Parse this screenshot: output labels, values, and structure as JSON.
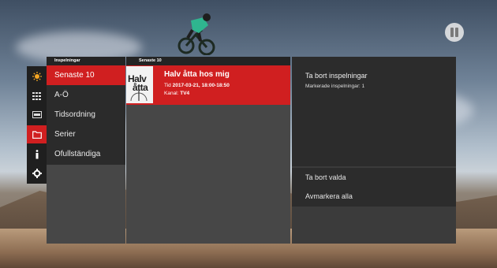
{
  "headers": {
    "left": "Inspelningar",
    "middle": "Senaste 10"
  },
  "rail": [
    {
      "icon": "sun-icon",
      "active": true
    },
    {
      "icon": "grid-icon",
      "active": false
    },
    {
      "icon": "film-icon",
      "active": false
    },
    {
      "icon": "folder-icon",
      "active": true
    },
    {
      "icon": "info-icon",
      "active": false
    },
    {
      "icon": "gear-icon",
      "active": false
    }
  ],
  "categories": [
    "Senaste 10",
    "A-Ö",
    "Tidsordning",
    "Serier",
    "Ofullständiga"
  ],
  "recording": {
    "thumb_line1": "Halv",
    "thumb_line2": "åtta",
    "title": "Halv åtta hos mig",
    "time_label": "Tid",
    "time_value": "2017-03-21, 18:00-18:50",
    "channel_label": "Kanal:",
    "channel_value": "TV4"
  },
  "delete_panel": {
    "title": "Ta bort inspelningar",
    "marked_label": "Markerade inspelningar: 1"
  },
  "actions": [
    "Ta bort valda",
    "Avmarkera alla"
  ],
  "colors": {
    "accent": "#d01f20",
    "panel_dark": "#2b2b2b",
    "panel_mid": "#474747"
  }
}
